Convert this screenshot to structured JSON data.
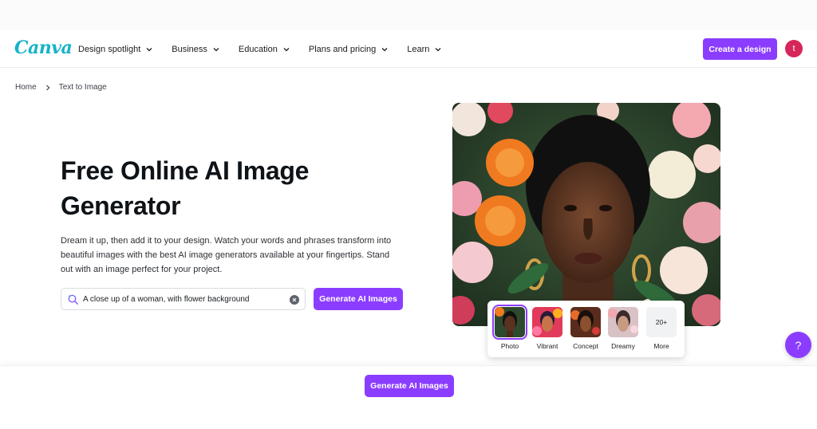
{
  "brand": {
    "logo_text": "Canva",
    "logo_color": "#16b3c9",
    "accent": "#8b3dff"
  },
  "nav": {
    "items": [
      {
        "label": "Design spotlight"
      },
      {
        "label": "Business"
      },
      {
        "label": "Education"
      },
      {
        "label": "Plans and pricing"
      },
      {
        "label": "Learn"
      }
    ],
    "create_label": "Create a design",
    "avatar_initial": "t"
  },
  "breadcrumb": {
    "home": "Home",
    "current": "Text to Image"
  },
  "hero": {
    "title": "Free Online AI Image Generator",
    "description": "Dream it up, then add it to your design. Watch your words and phrases transform into beautiful images with the best AI image generators available at your fingertips. Stand out with an image perfect for your project.",
    "search_value": "A close up of a woman, with flower background",
    "generate_label": "Generate AI Images"
  },
  "styles": {
    "options": [
      {
        "label": "Photo",
        "selected": true
      },
      {
        "label": "Vibrant",
        "selected": false
      },
      {
        "label": "Concept",
        "selected": false
      },
      {
        "label": "Dreamy",
        "selected": false
      },
      {
        "label": "More",
        "badge": "20+",
        "selected": false
      }
    ]
  },
  "help": {
    "label": "?"
  },
  "bottom": {
    "generate_label": "Generate AI Images"
  }
}
